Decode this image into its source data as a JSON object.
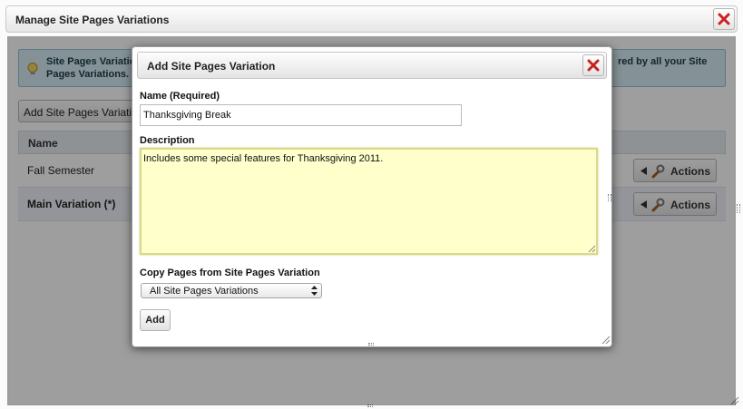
{
  "outer_dialog": {
    "title": "Manage Site Pages Variations",
    "info_text_left": "Site Pages Variatio Pages Variations.",
    "info_text_right": "red by all your Site",
    "add_button_label": "Add Site Pages Variatio",
    "table": {
      "columns": [
        "Name"
      ],
      "rows": [
        {
          "name": "Fall Semester",
          "action_label": "Actions"
        },
        {
          "name": "Main Variation (*)",
          "action_label": "Actions"
        }
      ]
    }
  },
  "modal": {
    "title": "Add Site Pages Variation",
    "name_label": "Name (Required)",
    "name_value": "Thanksgiving Break",
    "description_label": "Description",
    "description_value": "Includes some special features for Thanksgiving 2011.",
    "copy_label": "Copy Pages from Site Pages Variation",
    "copy_selected": "All Site Pages Variations",
    "add_button_label": "Add"
  },
  "icons": {
    "close": "close-icon",
    "info": "lightbulb-icon",
    "actions": "wrench-icon"
  },
  "colors": {
    "close_red": "#cc1f1f",
    "info_bg": "#d5ebf3",
    "textarea_bg": "#ffffcc"
  }
}
